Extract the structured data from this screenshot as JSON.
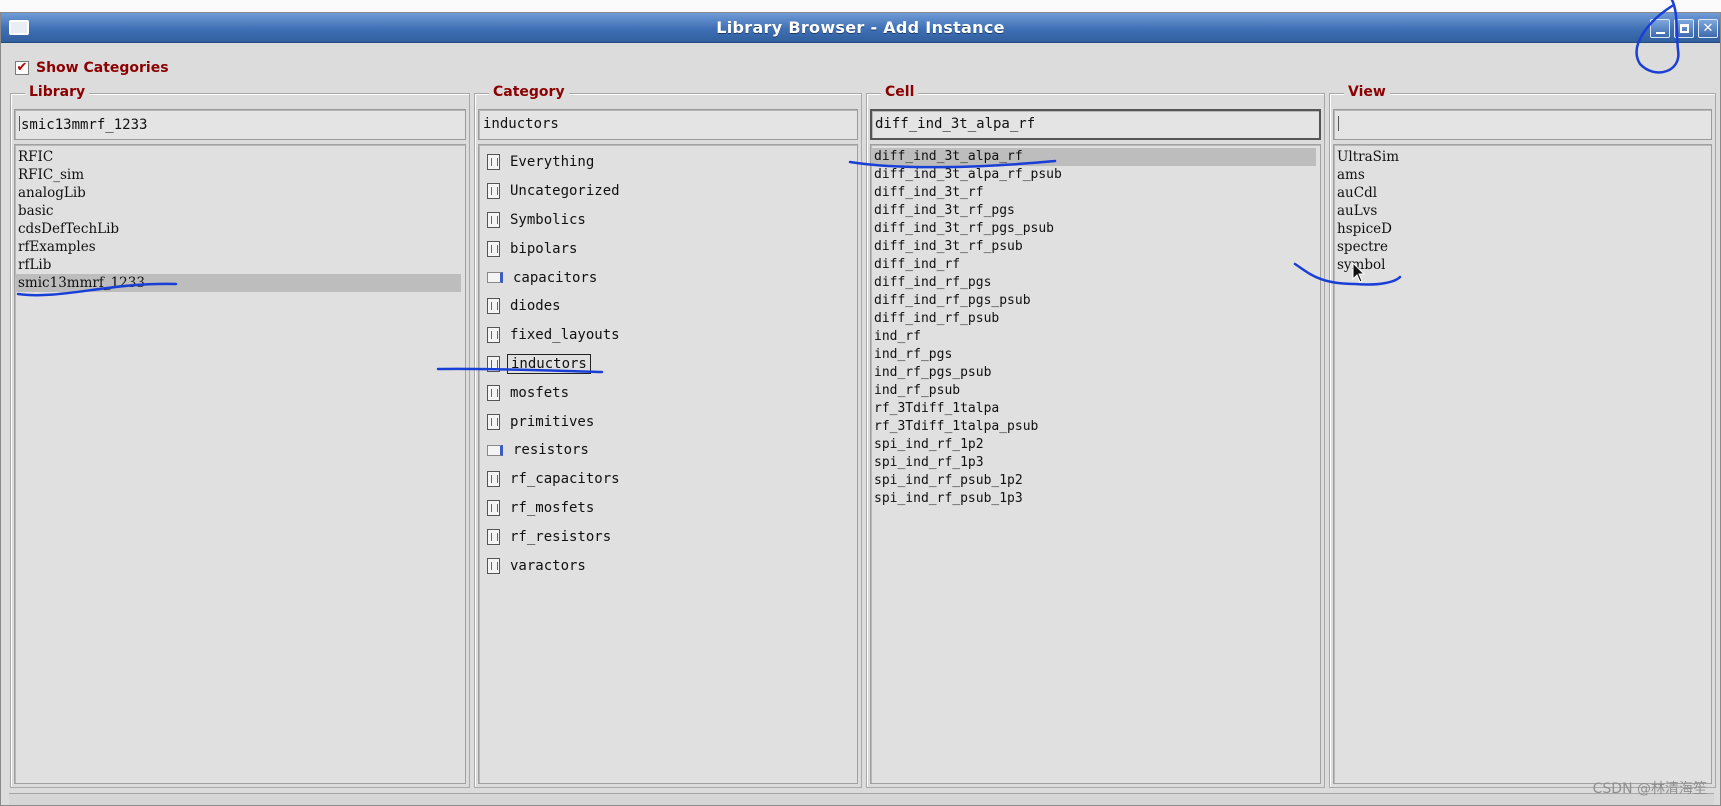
{
  "window": {
    "title": "Library Browser - Add Instance"
  },
  "show_categories": {
    "label": "Show Categories",
    "checked": true
  },
  "panes": {
    "library": {
      "label": "Library",
      "field_value": "smic13mmrf_1233",
      "items": [
        "RFIC",
        "RFIC_sim",
        "analogLib",
        "basic",
        "cdsDefTechLib",
        "rfExamples",
        "rfLib",
        "smic13mmrf_1233"
      ],
      "selected": "smic13mmrf_1233"
    },
    "category": {
      "label": "Category",
      "field_value": "inductors",
      "items": [
        {
          "label": "Everything",
          "icon": "category-doc-icon"
        },
        {
          "label": "Uncategorized",
          "icon": "category-doc-icon"
        },
        {
          "label": "Symbolics",
          "icon": "category-doc-icon"
        },
        {
          "label": "bipolars",
          "icon": "category-doc-icon"
        },
        {
          "label": "capacitors",
          "icon": "category-empty-icon"
        },
        {
          "label": "diodes",
          "icon": "category-doc-icon"
        },
        {
          "label": "fixed_layouts",
          "icon": "category-doc-icon"
        },
        {
          "label": "inductors",
          "icon": "category-doc-icon"
        },
        {
          "label": "mosfets",
          "icon": "category-doc-icon"
        },
        {
          "label": "primitives",
          "icon": "category-doc-icon"
        },
        {
          "label": "resistors",
          "icon": "category-empty-icon"
        },
        {
          "label": "rf_capacitors",
          "icon": "category-doc-icon"
        },
        {
          "label": "rf_mosfets",
          "icon": "category-doc-icon"
        },
        {
          "label": "rf_resistors",
          "icon": "category-doc-icon"
        },
        {
          "label": "varactors",
          "icon": "category-doc-icon"
        }
      ],
      "selected": "inductors"
    },
    "cell": {
      "label": "Cell",
      "field_value": "diff_ind_3t_alpa_rf",
      "items": [
        "diff_ind_3t_alpa_rf",
        "diff_ind_3t_alpa_rf_psub",
        "diff_ind_3t_rf",
        "diff_ind_3t_rf_pgs",
        "diff_ind_3t_rf_pgs_psub",
        "diff_ind_3t_rf_psub",
        "diff_ind_rf",
        "diff_ind_rf_pgs",
        "diff_ind_rf_pgs_psub",
        "diff_ind_rf_psub",
        "ind_rf",
        "ind_rf_pgs",
        "ind_rf_pgs_psub",
        "ind_rf_psub",
        "rf_3Tdiff_1talpa",
        "rf_3Tdiff_1talpa_psub",
        "spi_ind_rf_1p2",
        "spi_ind_rf_1p3",
        "spi_ind_rf_psub_1p2",
        "spi_ind_rf_psub_1p3"
      ],
      "selected": "diff_ind_3t_alpa_rf"
    },
    "view": {
      "label": "View",
      "field_value": "",
      "items": [
        "UltraSim",
        "ams",
        "auCdl",
        "auLvs",
        "hspiceD",
        "spectre",
        "symbol"
      ]
    }
  },
  "watermark": "CSDN @林清海笙",
  "colors": {
    "titlebar": "#3f6fb5",
    "section_label": "#8b0000",
    "annotation_ink": "#1a3fd6",
    "selection": "#bdbdbd"
  }
}
